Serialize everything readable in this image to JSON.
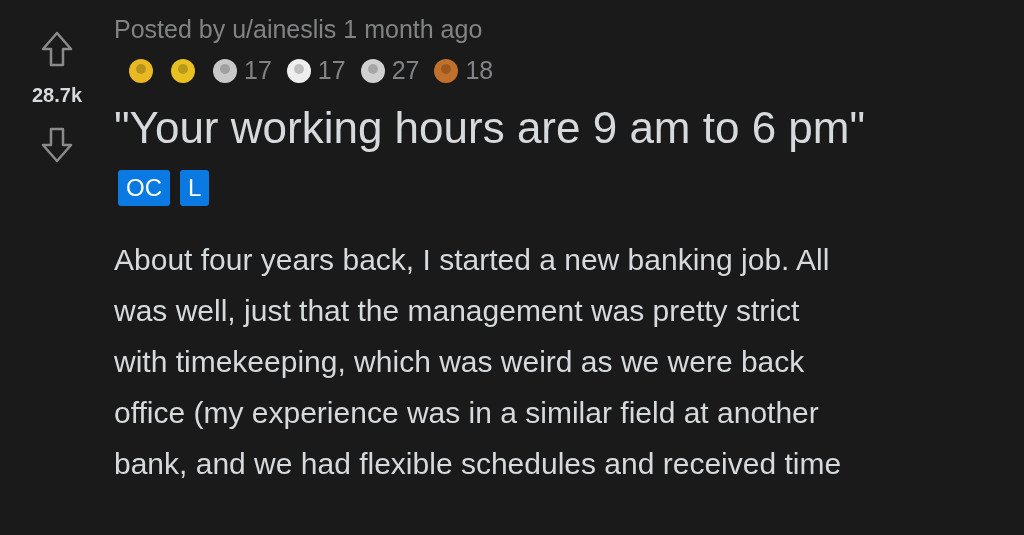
{
  "vote": {
    "score": "28.7k",
    "upvoted": false,
    "downvoted": false
  },
  "meta": "Posted by u/aineslis 1 month ago",
  "awards": [
    {
      "color": "#e8b923"
    },
    {
      "color": "#e8c020"
    },
    {
      "color": "#c8c8c8",
      "count": "17"
    },
    {
      "color": "#eeeeee",
      "count": "17"
    },
    {
      "color": "#d0d0d0",
      "count": "27"
    },
    {
      "color": "#c0702a",
      "count": "18"
    }
  ],
  "title": "\"Your working hours are 9 am to 6 pm\"",
  "flairs": [
    "OC",
    "L"
  ],
  "body_lines": [
    "About four years back, I started a new banking job. All",
    "was well, just that the management was pretty strict",
    "with timekeeping, which was weird as we were back",
    "office (my experience was in a similar field at another",
    "bank, and we had flexible schedules and received time"
  ]
}
